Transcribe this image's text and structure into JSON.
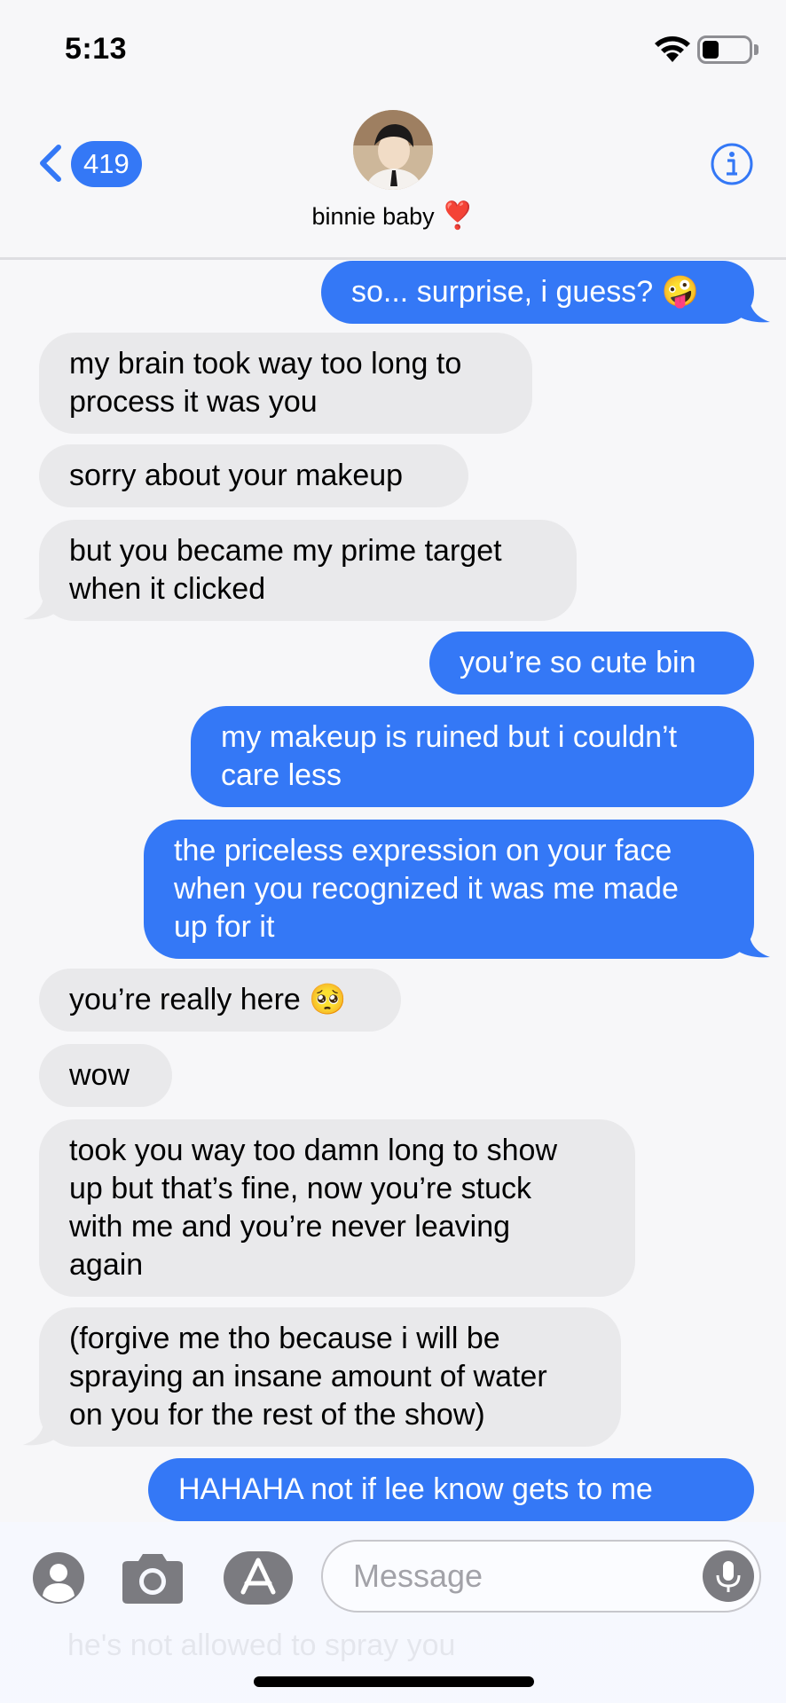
{
  "status_bar": {
    "time": "5:13",
    "battery_level": 0.35
  },
  "header": {
    "back_count": "419",
    "contact_name": "binnie baby",
    "contact_emoji": "❣️"
  },
  "messages": [
    {
      "from": "me",
      "text": "so... surprise, i guess? 🤪"
    },
    {
      "from": "them",
      "text": "my brain took way too long to\nprocess it was you"
    },
    {
      "from": "them",
      "text": "sorry about your makeup"
    },
    {
      "from": "them",
      "text": "but you became my prime target\nwhen it clicked"
    },
    {
      "from": "me",
      "text": "you’re so cute bin"
    },
    {
      "from": "me",
      "text": "my makeup is ruined but i couldn’t\ncare less"
    },
    {
      "from": "me",
      "text": "the priceless expression on your face\nwhen you recognized it was me made\nup for it"
    },
    {
      "from": "them",
      "text": "you’re really here 🥺"
    },
    {
      "from": "them",
      "text": "wow"
    },
    {
      "from": "them",
      "text": "took you way too damn long to show\nup but that’s fine, now you’re stuck\nwith me and you’re never leaving\nagain"
    },
    {
      "from": "them",
      "text": "(forgive me tho because i will be\nspraying an insane amount of water\non you for the rest of the show)"
    },
    {
      "from": "me",
      "text": "HAHAHA not if lee know gets to me"
    }
  ],
  "composer": {
    "placeholder": "Message",
    "ghost_text": "he's not allowed to spray you"
  },
  "colors": {
    "sent": "#3478f6",
    "received": "#e9e9eb",
    "accent": "#3478f6"
  }
}
